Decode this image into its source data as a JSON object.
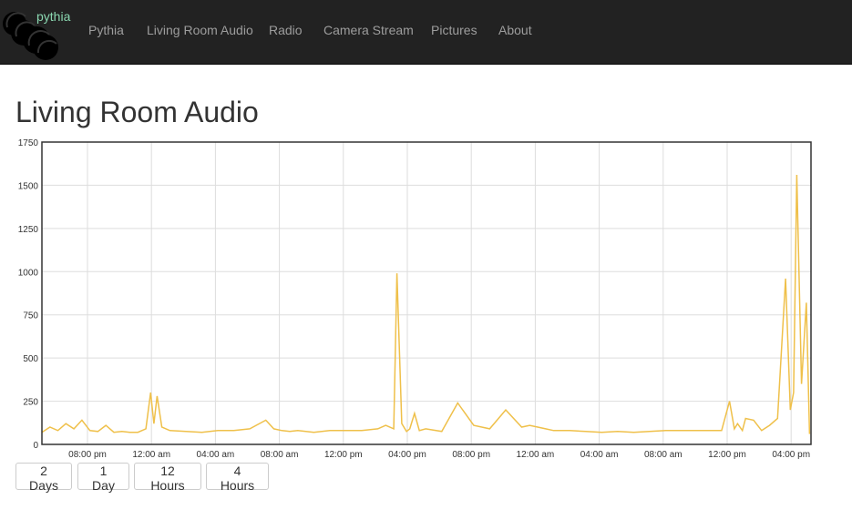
{
  "nav": {
    "brand": "pythia",
    "items": [
      {
        "label": "Pythia"
      },
      {
        "label": "Living Room Audio"
      },
      {
        "label": "Radio"
      },
      {
        "label": "Camera Stream"
      },
      {
        "label": "Pictures"
      },
      {
        "label": "About"
      }
    ]
  },
  "page": {
    "title": "Living Room Audio"
  },
  "chart_data": {
    "type": "line",
    "title": "",
    "xlabel": "",
    "ylabel": "",
    "ylim": [
      0,
      1750
    ],
    "yticks": [
      0,
      250,
      500,
      750,
      1000,
      1250,
      1500,
      1750
    ],
    "xtick_labels": [
      "08:00 pm",
      "12:00 am",
      "04:00 am",
      "08:00 am",
      "12:00 pm",
      "04:00 pm",
      "08:00 pm",
      "12:00 am",
      "04:00 am",
      "08:00 am",
      "12:00 pm",
      "04:00 pm"
    ],
    "grid": true,
    "series": [
      {
        "color": "#efc04a",
        "x_hours": [
          0,
          0.5,
          1,
          1.5,
          2,
          2.5,
          3,
          3.5,
          4,
          4.5,
          5,
          5.5,
          6,
          6.5,
          6.8,
          7,
          7.2,
          7.5,
          8,
          9,
          10,
          11,
          12,
          13,
          14,
          14.5,
          15,
          15.5,
          16,
          17,
          18,
          19,
          20,
          21,
          21.5,
          22,
          22.2,
          22.5,
          22.8,
          23,
          23.3,
          23.6,
          24,
          25,
          26,
          27,
          28,
          29,
          30,
          30.5,
          31,
          31.5,
          32,
          33,
          34,
          35,
          36,
          37,
          38,
          39,
          40,
          41,
          42,
          42.5,
          43,
          43.3,
          43.5,
          43.8,
          44,
          44.5,
          45,
          45.5,
          46,
          46.5,
          46.8,
          47,
          47.2,
          47.5,
          47.8,
          48
        ],
        "y": [
          70,
          100,
          80,
          120,
          90,
          140,
          80,
          75,
          110,
          70,
          75,
          70,
          70,
          90,
          300,
          120,
          280,
          100,
          80,
          75,
          70,
          80,
          80,
          90,
          140,
          90,
          80,
          75,
          80,
          70,
          80,
          80,
          80,
          90,
          110,
          90,
          990,
          120,
          75,
          90,
          180,
          80,
          90,
          75,
          240,
          110,
          90,
          200,
          100,
          110,
          100,
          90,
          80,
          80,
          75,
          70,
          75,
          70,
          75,
          80,
          80,
          80,
          80,
          80,
          250,
          90,
          120,
          80,
          150,
          140,
          80,
          110,
          150,
          960,
          200,
          300,
          1560,
          350,
          820,
          60
        ]
      }
    ]
  },
  "range_buttons": [
    {
      "label": "2 Days"
    },
    {
      "label": "1 Day"
    },
    {
      "label": "12 Hours"
    },
    {
      "label": "4 Hours"
    }
  ]
}
